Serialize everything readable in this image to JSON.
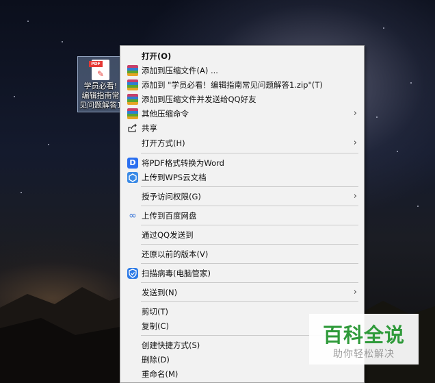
{
  "desktop_icon": {
    "label": "学员必看!\n编辑指南常\n见问题解答1",
    "badge": "PDF",
    "icon": "pdf-file-icon"
  },
  "context_menu": {
    "items": [
      {
        "id": "open",
        "label": "打开(O)",
        "bold": true,
        "icon": null,
        "submenu": false
      },
      {
        "id": "add-archive",
        "label": "添加到压缩文件(A) ...",
        "icon": "winrar-icon",
        "submenu": false
      },
      {
        "id": "add-zip",
        "label": "添加到 \"学员必看！编辑指南常见问题解答1.zip\"(T)",
        "icon": "winrar-icon",
        "submenu": false
      },
      {
        "id": "add-send-qq",
        "label": "添加到压缩文件并发送给QQ好友",
        "icon": "winrar-icon",
        "submenu": false
      },
      {
        "id": "other-compress",
        "label": "其他压缩命令",
        "icon": "winrar-icon",
        "submenu": true
      },
      {
        "id": "share",
        "label": "共享",
        "icon": "share-icon",
        "submenu": false
      },
      {
        "id": "open-with",
        "label": "打开方式(H)",
        "icon": null,
        "submenu": true
      },
      {
        "id": "pdf-to-word",
        "label": "将PDF格式转换为Word",
        "icon": "wps-pdf-icon",
        "submenu": false
      },
      {
        "id": "upload-wps",
        "label": "上传到WPS云文档",
        "icon": "wps-cloud-icon",
        "submenu": false
      },
      {
        "id": "grant-access",
        "label": "授予访问权限(G)",
        "icon": null,
        "submenu": true
      },
      {
        "id": "upload-baidu",
        "label": "上传到百度网盘",
        "icon": "baidu-netdisk-icon",
        "submenu": false
      },
      {
        "id": "send-qq",
        "label": "通过QQ发送到",
        "icon": null,
        "submenu": false
      },
      {
        "id": "restore",
        "label": "还原以前的版本(V)",
        "icon": null,
        "submenu": false
      },
      {
        "id": "scan",
        "label": "扫描病毒(电脑管家)",
        "icon": "pc-manager-shield-icon",
        "submenu": false
      },
      {
        "id": "send-to",
        "label": "发送到(N)",
        "icon": null,
        "submenu": true
      },
      {
        "id": "cut",
        "label": "剪切(T)",
        "icon": null,
        "submenu": false
      },
      {
        "id": "copy",
        "label": "复制(C)",
        "icon": null,
        "submenu": false
      },
      {
        "id": "create-shortcut",
        "label": "创建快捷方式(S)",
        "icon": null,
        "submenu": false
      },
      {
        "id": "delete",
        "label": "删除(D)",
        "icon": null,
        "submenu": false
      },
      {
        "id": "rename",
        "label": "重命名(M)",
        "icon": null,
        "submenu": false
      }
    ]
  },
  "watermark": {
    "title": "百科全说",
    "subtitle": "助你轻松解决",
    "color": "#2f9a3a"
  }
}
